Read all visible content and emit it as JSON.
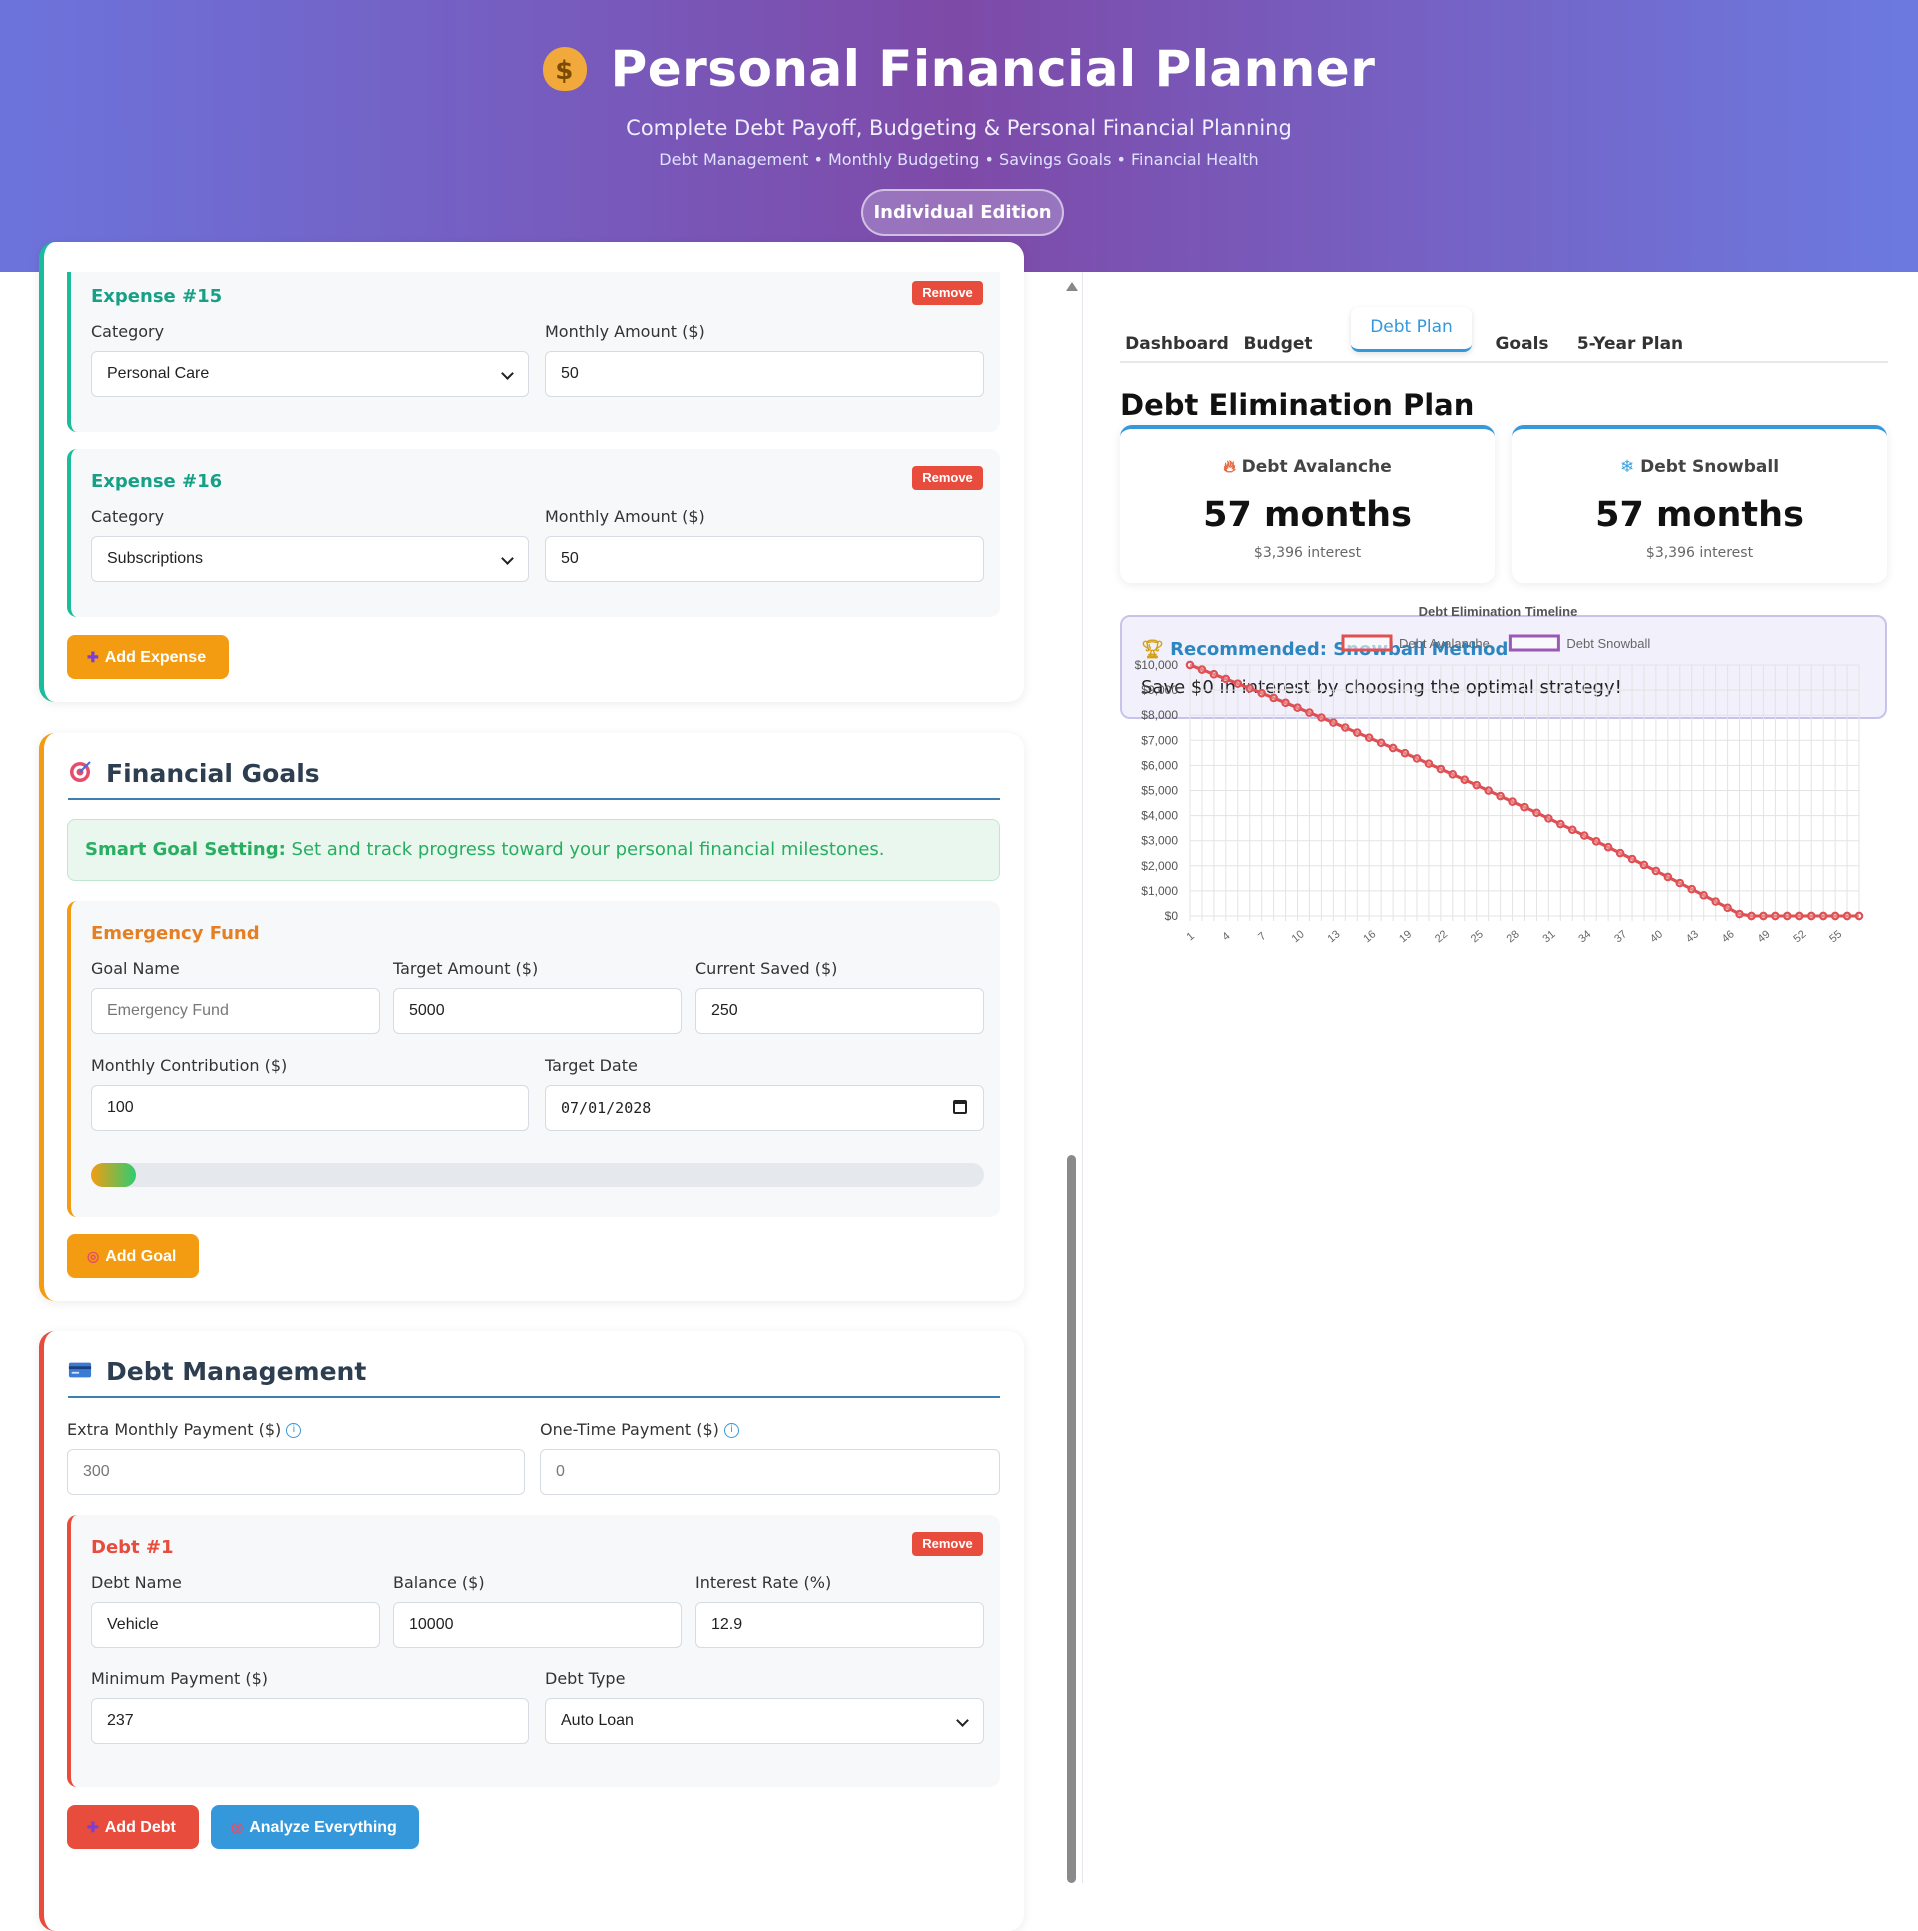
{
  "header": {
    "icon": "money-bag-icon",
    "title": "Personal Financial Planner",
    "subtitle": "Complete Debt Payoff, Budgeting & Personal Financial Planning",
    "tagline": "Debt Management • Monthly Budgeting • Savings Goals • Financial Health",
    "edition": "Individual Edition"
  },
  "expenses": {
    "items": [
      {
        "title": "Expense #15",
        "category_label": "Category",
        "category": "Personal Care",
        "amount_label": "Monthly Amount ($)",
        "amount": "50",
        "remove": "Remove"
      },
      {
        "title": "Expense #16",
        "category_label": "Category",
        "category": "Subscriptions",
        "amount_label": "Monthly Amount ($)",
        "amount": "50",
        "remove": "Remove"
      }
    ],
    "add_button": "Add Expense"
  },
  "goals": {
    "title": "Financial Goals",
    "notice_bold": "Smart Goal Setting:",
    "notice_text": "Set and track progress toward your personal financial milestones.",
    "goal": {
      "title": "Emergency Fund",
      "name_label": "Goal Name",
      "name_placeholder": "Emergency Fund",
      "target_label": "Target Amount ($)",
      "target": "5000",
      "saved_label": "Current Saved ($)",
      "saved": "250",
      "contribution_label": "Monthly Contribution ($)",
      "contribution": "100",
      "date_label": "Target Date",
      "date": "07/01/2028",
      "progress_fraction": 0.05
    },
    "add_button": "Add Goal"
  },
  "debt_mgmt": {
    "title": "Debt Management",
    "extra_label": "Extra Monthly Payment ($)",
    "extra_placeholder": "300",
    "onetime_label": "One-Time Payment ($)",
    "onetime_placeholder": "0",
    "debt": {
      "title": "Debt #1",
      "remove": "Remove",
      "name_label": "Debt Name",
      "name": "Vehicle",
      "balance_label": "Balance ($)",
      "balance": "10000",
      "rate_label": "Interest Rate (%)",
      "rate": "12.9",
      "min_label": "Minimum Payment ($)",
      "min": "237",
      "type_label": "Debt Type",
      "type": "Auto Loan"
    },
    "add_button": "Add Debt",
    "analyze_button": "Analyze Everything"
  },
  "tabs": [
    "Dashboard",
    "Budget",
    "Debt Plan",
    "Goals",
    "5-Year Plan"
  ],
  "active_tab": "Debt Plan",
  "plan": {
    "title": "Debt Elimination Plan",
    "avalanche": {
      "label": "Debt Avalanche",
      "months": "57 months",
      "interest": "$3,396 interest",
      "icon": "fire-icon"
    },
    "snowball": {
      "label": "Debt Snowball",
      "months": "57 months",
      "interest": "$3,396 interest",
      "icon": "snowflake-icon"
    },
    "recommend_title": "Recommended: Snowball Method",
    "recommend_text": "Save $0 in interest by choosing the optimal strategy!"
  },
  "colors": {
    "accent": "#3498db",
    "expense": "#1abc9c",
    "goal": "#f39c12",
    "debt": "#e74c3c",
    "avalanche": "#e05050",
    "snowball": "#9b59b6"
  },
  "chart_data": {
    "type": "line",
    "title": "Debt Elimination Timeline",
    "x": [
      1,
      2,
      3,
      4,
      5,
      6,
      7,
      8,
      9,
      10,
      11,
      12,
      13,
      14,
      15,
      16,
      17,
      18,
      19,
      20,
      21,
      22,
      23,
      24,
      25,
      26,
      27,
      28,
      29,
      30,
      31,
      32,
      33,
      34,
      35,
      36,
      37,
      38,
      39,
      40,
      41,
      42,
      43,
      44,
      45,
      46,
      47,
      48,
      49,
      50,
      51,
      52,
      53,
      54,
      55,
      56,
      57
    ],
    "x_tick_labels": [
      "1",
      "4",
      "7",
      "10",
      "13",
      "16",
      "19",
      "22",
      "25",
      "28",
      "31",
      "34",
      "37",
      "40",
      "43",
      "46",
      "49",
      "52",
      "55"
    ],
    "series": [
      {
        "name": "Debt Avalanche",
        "color": "#e05050",
        "values": [
          10000,
          9816,
          9631,
          9445,
          9257,
          9068,
          8878,
          8686,
          8493,
          8299,
          8103,
          7906,
          7707,
          7507,
          7306,
          7103,
          6899,
          6693,
          6486,
          6278,
          6068,
          5856,
          5643,
          5429,
          5213,
          4996,
          4777,
          4557,
          4335,
          4112,
          3887,
          3661,
          3433,
          3204,
          2973,
          2740,
          2506,
          2270,
          2033,
          1794,
          1554,
          1312,
          1068,
          823,
          576,
          328,
          78,
          0,
          0,
          0,
          0,
          0,
          0,
          0,
          0,
          0,
          0
        ]
      },
      {
        "name": "Debt Snowball",
        "color": "#9b59b6",
        "values": [
          10000,
          9816,
          9631,
          9445,
          9257,
          9068,
          8878,
          8686,
          8493,
          8299,
          8103,
          7906,
          7707,
          7507,
          7306,
          7103,
          6899,
          6693,
          6486,
          6278,
          6068,
          5856,
          5643,
          5429,
          5213,
          4996,
          4777,
          4557,
          4335,
          4112,
          3887,
          3661,
          3433,
          3204,
          2973,
          2740,
          2506,
          2270,
          2033,
          1794,
          1554,
          1312,
          1068,
          823,
          576,
          328,
          78,
          0,
          0,
          0,
          0,
          0,
          0,
          0,
          0,
          0,
          0
        ]
      }
    ],
    "y_tick_labels": [
      "$10,000",
      "$9,000",
      "$8,000",
      "$7,000",
      "$6,000",
      "$5,000",
      "$4,000",
      "$3,000",
      "$2,000",
      "$1,000",
      "$0"
    ],
    "ylim": [
      0,
      10000
    ],
    "grid": true,
    "legend": "top"
  }
}
